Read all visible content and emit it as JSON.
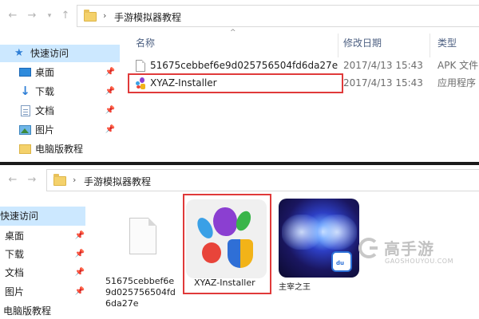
{
  "top": {
    "address": {
      "path": "手游模拟器教程",
      "separator": "›"
    },
    "nav": [
      {
        "label": "快速访问",
        "icon": "star-icon",
        "selected": true,
        "pinned": false
      },
      {
        "label": "桌面",
        "icon": "desktop-icon",
        "pinned": true
      },
      {
        "label": "下载",
        "icon": "download-icon",
        "pinned": true
      },
      {
        "label": "文档",
        "icon": "documents-icon",
        "pinned": true
      },
      {
        "label": "图片",
        "icon": "pictures-icon",
        "pinned": true
      },
      {
        "label": "电脑版教程",
        "icon": "folder-icon",
        "pinned": false
      }
    ],
    "columns": {
      "name": "名称",
      "date": "修改日期",
      "type": "类型"
    },
    "files": [
      {
        "name": "51675cebbef6e9d025756504fd6da27e",
        "date": "2017/4/13 15:43",
        "type": "APK 文件",
        "icon": "file-icon"
      },
      {
        "name": "XYAZ-Installer",
        "date": "2017/4/13 15:43",
        "type": "应用程序",
        "icon": "xyaz-app-icon",
        "highlighted": true
      }
    ]
  },
  "bottom": {
    "address": {
      "path": "手游模拟器教程",
      "separator": "›"
    },
    "nav": [
      {
        "label": "快速访问",
        "selected": true
      },
      {
        "label": "桌面",
        "pinned": true
      },
      {
        "label": "下载",
        "pinned": true
      },
      {
        "label": "文档",
        "pinned": true
      },
      {
        "label": "图片",
        "pinned": true
      },
      {
        "label": "电脑版教程",
        "pinned": false
      }
    ],
    "tiles": [
      {
        "label": "51675cebbef6e9d025756504fd6da27e",
        "icon": "blank-file-icon"
      },
      {
        "label": "XYAZ-Installer",
        "icon": "xyaz-app-icon",
        "highlighted": true
      },
      {
        "label": "主宰之王",
        "icon": "game-app-icon"
      }
    ]
  },
  "watermark": {
    "cn": "高手游",
    "en": "GAOSHOUYOU.COM"
  },
  "colors": {
    "highlight": "#e03a3a",
    "selection": "#cce8ff",
    "folder": "#f4d16b"
  }
}
